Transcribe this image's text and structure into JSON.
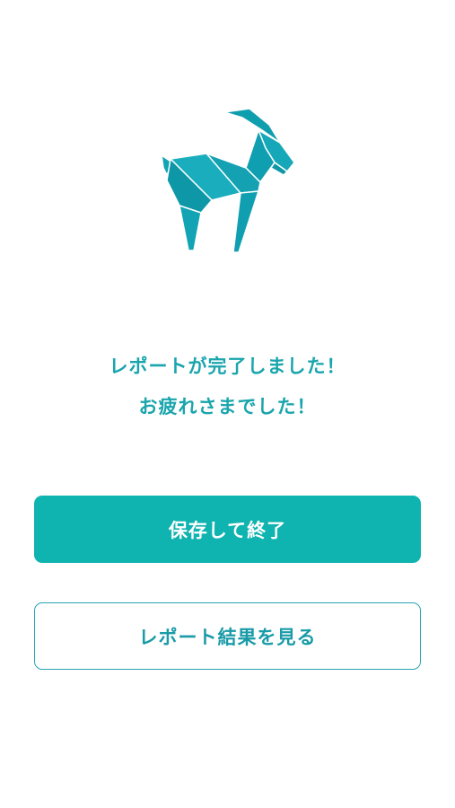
{
  "colors": {
    "accent": "#1aa5ad",
    "primary_button": "#0fb3b0",
    "secondary_border": "#2aa3b3",
    "logo_fill": "#12a4b4"
  },
  "logo": {
    "icon": "origami-goat-icon"
  },
  "message": {
    "line1": "レポートが完了しました！",
    "line2": "お疲れさまでした！"
  },
  "buttons": {
    "save_and_finish": "保存して終了",
    "view_report": "レポート結果を見る"
  }
}
